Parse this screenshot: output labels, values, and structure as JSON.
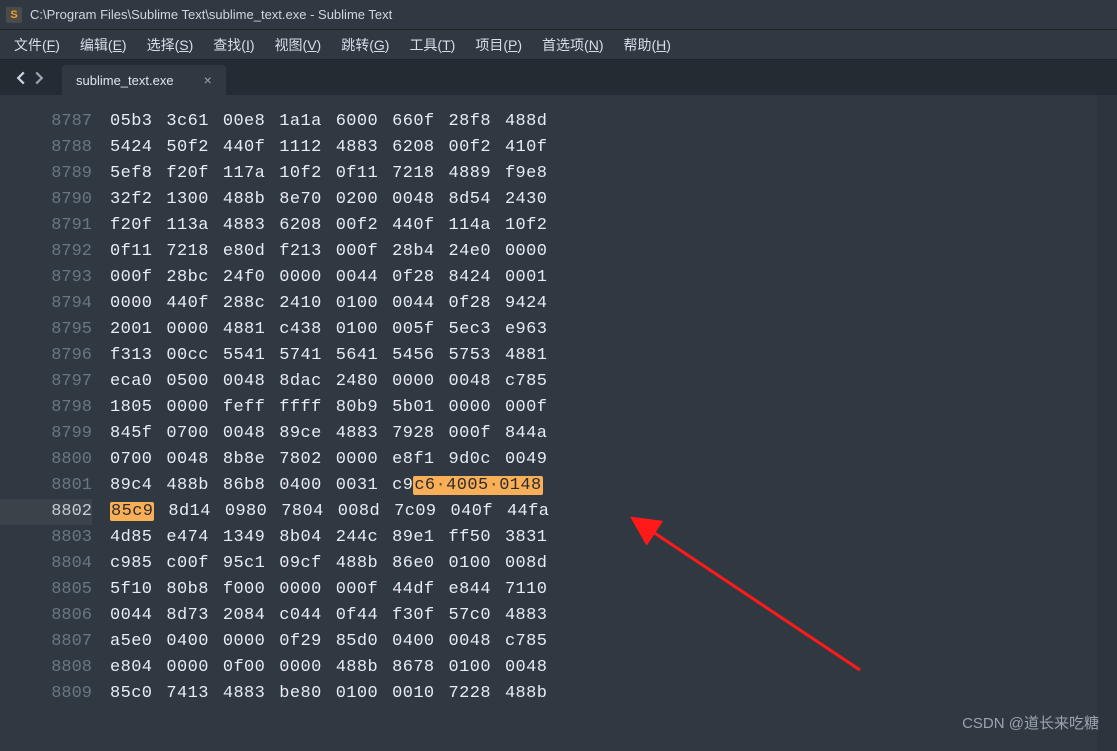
{
  "window": {
    "title": "C:\\Program Files\\Sublime Text\\sublime_text.exe - Sublime Text",
    "app_icon_letter": "S"
  },
  "menu": {
    "items": [
      {
        "label": "文件",
        "accel": "F"
      },
      {
        "label": "编辑",
        "accel": "E"
      },
      {
        "label": "选择",
        "accel": "S"
      },
      {
        "label": "查找",
        "accel": "I"
      },
      {
        "label": "视图",
        "accel": "V"
      },
      {
        "label": "跳转",
        "accel": "G"
      },
      {
        "label": "工具",
        "accel": "T"
      },
      {
        "label": "项目",
        "accel": "P"
      },
      {
        "label": "首选项",
        "accel": "N"
      },
      {
        "label": "帮助",
        "accel": "H"
      }
    ]
  },
  "tabs": {
    "active": {
      "label": "sublime_text.exe"
    }
  },
  "editor": {
    "partial_first_line": {
      "ln": "",
      "hex": [
        "",
        "",
        "",
        "",
        "",
        "",
        "",
        ""
      ]
    },
    "active_line": 8802,
    "highlight": {
      "line_a": 8801,
      "a_prefix_in_group6": "c9",
      "a_hl": "c6·4005·0148",
      "line_b": 8802,
      "b_hl": "85c9"
    },
    "lines": [
      {
        "ln": 8787,
        "hex": [
          "05b3",
          "3c61",
          "00e8",
          "1a1a",
          "6000",
          "660f",
          "28f8",
          "488d"
        ]
      },
      {
        "ln": 8788,
        "hex": [
          "5424",
          "50f2",
          "440f",
          "1112",
          "4883",
          "6208",
          "00f2",
          "410f"
        ]
      },
      {
        "ln": 8789,
        "hex": [
          "5ef8",
          "f20f",
          "117a",
          "10f2",
          "0f11",
          "7218",
          "4889",
          "f9e8"
        ]
      },
      {
        "ln": 8790,
        "hex": [
          "32f2",
          "1300",
          "488b",
          "8e70",
          "0200",
          "0048",
          "8d54",
          "2430"
        ]
      },
      {
        "ln": 8791,
        "hex": [
          "f20f",
          "113a",
          "4883",
          "6208",
          "00f2",
          "440f",
          "114a",
          "10f2"
        ]
      },
      {
        "ln": 8792,
        "hex": [
          "0f11",
          "7218",
          "e80d",
          "f213",
          "000f",
          "28b4",
          "24e0",
          "0000"
        ]
      },
      {
        "ln": 8793,
        "hex": [
          "000f",
          "28bc",
          "24f0",
          "0000",
          "0044",
          "0f28",
          "8424",
          "0001"
        ]
      },
      {
        "ln": 8794,
        "hex": [
          "0000",
          "440f",
          "288c",
          "2410",
          "0100",
          "0044",
          "0f28",
          "9424"
        ]
      },
      {
        "ln": 8795,
        "hex": [
          "2001",
          "0000",
          "4881",
          "c438",
          "0100",
          "005f",
          "5ec3",
          "e963"
        ]
      },
      {
        "ln": 8796,
        "hex": [
          "f313",
          "00cc",
          "5541",
          "5741",
          "5641",
          "5456",
          "5753",
          "4881"
        ]
      },
      {
        "ln": 8797,
        "hex": [
          "eca0",
          "0500",
          "0048",
          "8dac",
          "2480",
          "0000",
          "0048",
          "c785"
        ]
      },
      {
        "ln": 8798,
        "hex": [
          "1805",
          "0000",
          "feff",
          "ffff",
          "80b9",
          "5b01",
          "0000",
          "000f"
        ]
      },
      {
        "ln": 8799,
        "hex": [
          "845f",
          "0700",
          "0048",
          "89ce",
          "4883",
          "7928",
          "000f",
          "844a"
        ]
      },
      {
        "ln": 8800,
        "hex": [
          "0700",
          "0048",
          "8b8e",
          "7802",
          "0000",
          "e8f1",
          "9d0c",
          "0049"
        ]
      },
      {
        "ln": 8801,
        "hex": [
          "89c4",
          "488b",
          "86b8",
          "0400",
          "0031",
          "c9",
          "c6·4005·0148"
        ],
        "special": "a"
      },
      {
        "ln": 8802,
        "hex": [
          "85c9",
          "8d14",
          "0980",
          "7804",
          "008d",
          "7c09",
          "040f",
          "44fa"
        ],
        "special": "b"
      },
      {
        "ln": 8803,
        "hex": [
          "4d85",
          "e474",
          "1349",
          "8b04",
          "244c",
          "89e1",
          "ff50",
          "3831"
        ]
      },
      {
        "ln": 8804,
        "hex": [
          "c985",
          "c00f",
          "95c1",
          "09cf",
          "488b",
          "86e0",
          "0100",
          "008d"
        ]
      },
      {
        "ln": 8805,
        "hex": [
          "5f10",
          "80b8",
          "f000",
          "0000",
          "000f",
          "44df",
          "e844",
          "7110"
        ]
      },
      {
        "ln": 8806,
        "hex": [
          "0044",
          "8d73",
          "2084",
          "c044",
          "0f44",
          "f30f",
          "57c0",
          "4883"
        ]
      },
      {
        "ln": 8807,
        "hex": [
          "a5e0",
          "0400",
          "0000",
          "0f29",
          "85d0",
          "0400",
          "0048",
          "c785"
        ]
      },
      {
        "ln": 8808,
        "hex": [
          "e804",
          "0000",
          "0f00",
          "0000",
          "488b",
          "8678",
          "0100",
          "0048"
        ]
      },
      {
        "ln": 8809,
        "hex": [
          "85c0",
          "7413",
          "4883",
          "be80",
          "0100",
          "0010",
          "7228",
          "488b"
        ]
      }
    ]
  },
  "watermark": "CSDN @道长来吃糖"
}
